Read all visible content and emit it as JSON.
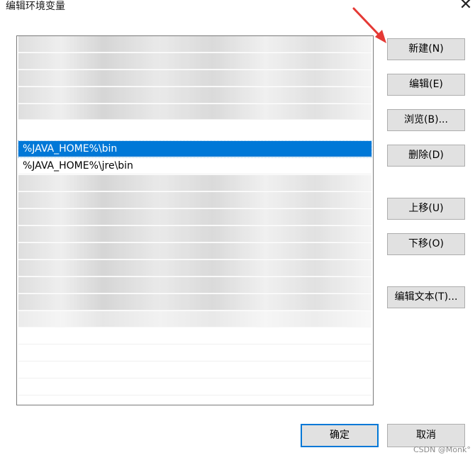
{
  "window": {
    "title": "编辑环境变量"
  },
  "list": {
    "selected_item": "%JAVA_HOME%\\bin",
    "second_item": "%JAVA_HOME%\\jre\\bin"
  },
  "buttons": {
    "new": "新建(N)",
    "edit": "编辑(E)",
    "browse": "浏览(B)...",
    "delete": "删除(D)",
    "move_up": "上移(U)",
    "move_down": "下移(O)",
    "edit_text": "编辑文本(T)...",
    "ok": "确定",
    "cancel": "取消"
  },
  "watermark": "CSDN @Monk°",
  "colors": {
    "selection": "#0078d7",
    "arrow": "#e53935"
  }
}
